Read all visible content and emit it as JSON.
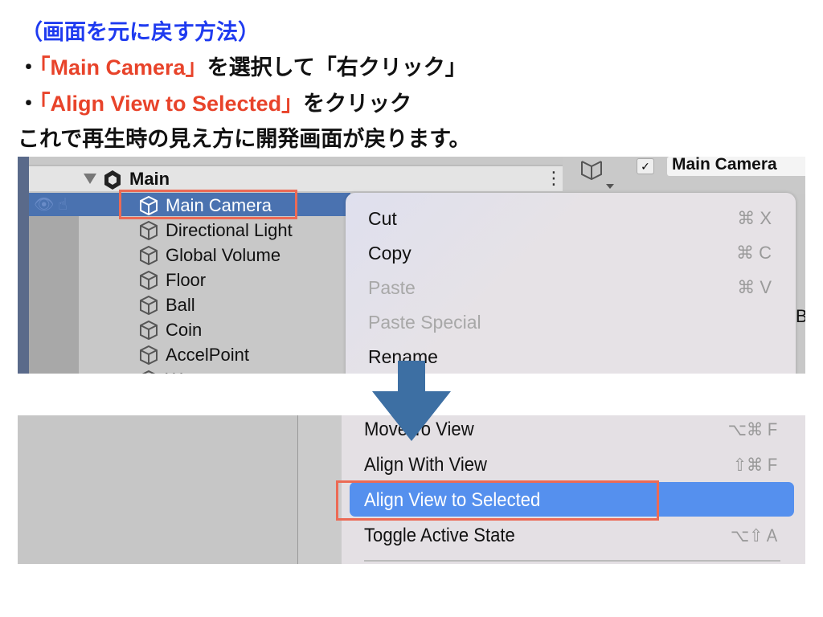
{
  "instructions": {
    "heading": "（画面を元に戻す方法）",
    "step1": {
      "bullet": "・",
      "highlight": "「Main Camera」",
      "rest": "を選択して「右クリック」"
    },
    "step2": {
      "bullet": "・",
      "highlight": "「Align View to Selected」",
      "rest": "をクリック"
    },
    "summary": "これで再生時の見え方に開発画面が戻ります。"
  },
  "hierarchy": {
    "scene": "Main",
    "items": [
      "Main Camera",
      "Directional Light",
      "Global Volume",
      "Floor",
      "Ball",
      "Coin",
      "AccelPoint",
      "W"
    ],
    "selected": "Main Camera"
  },
  "inspector": {
    "name": "Main Camera",
    "partial": "Ba"
  },
  "menu_top": [
    {
      "label": "Cut",
      "shortcut": "⌘ X",
      "enabled": true
    },
    {
      "label": "Copy",
      "shortcut": "⌘ C",
      "enabled": true
    },
    {
      "label": "Paste",
      "shortcut": "⌘ V",
      "enabled": false
    },
    {
      "label": "Paste Special",
      "shortcut": "",
      "enabled": false
    },
    {
      "label": "Rename",
      "shortcut": "",
      "enabled": true
    }
  ],
  "menu_bottom": [
    {
      "label": "Move To View",
      "shortcut": "⌥⌘ F"
    },
    {
      "label": "Align With View",
      "shortcut": "⇧⌘ F"
    },
    {
      "label": "Align View to Selected",
      "shortcut": "",
      "highlighted": true
    },
    {
      "label": "Toggle Active State",
      "shortcut": "⌥⇧ A"
    }
  ],
  "colors": {
    "accent_red": "#e8432a",
    "heading_blue": "#1f3bf0",
    "selection": "#4a72b0",
    "menu_highlight": "#5590ee",
    "arrow": "#3d6fa3"
  }
}
